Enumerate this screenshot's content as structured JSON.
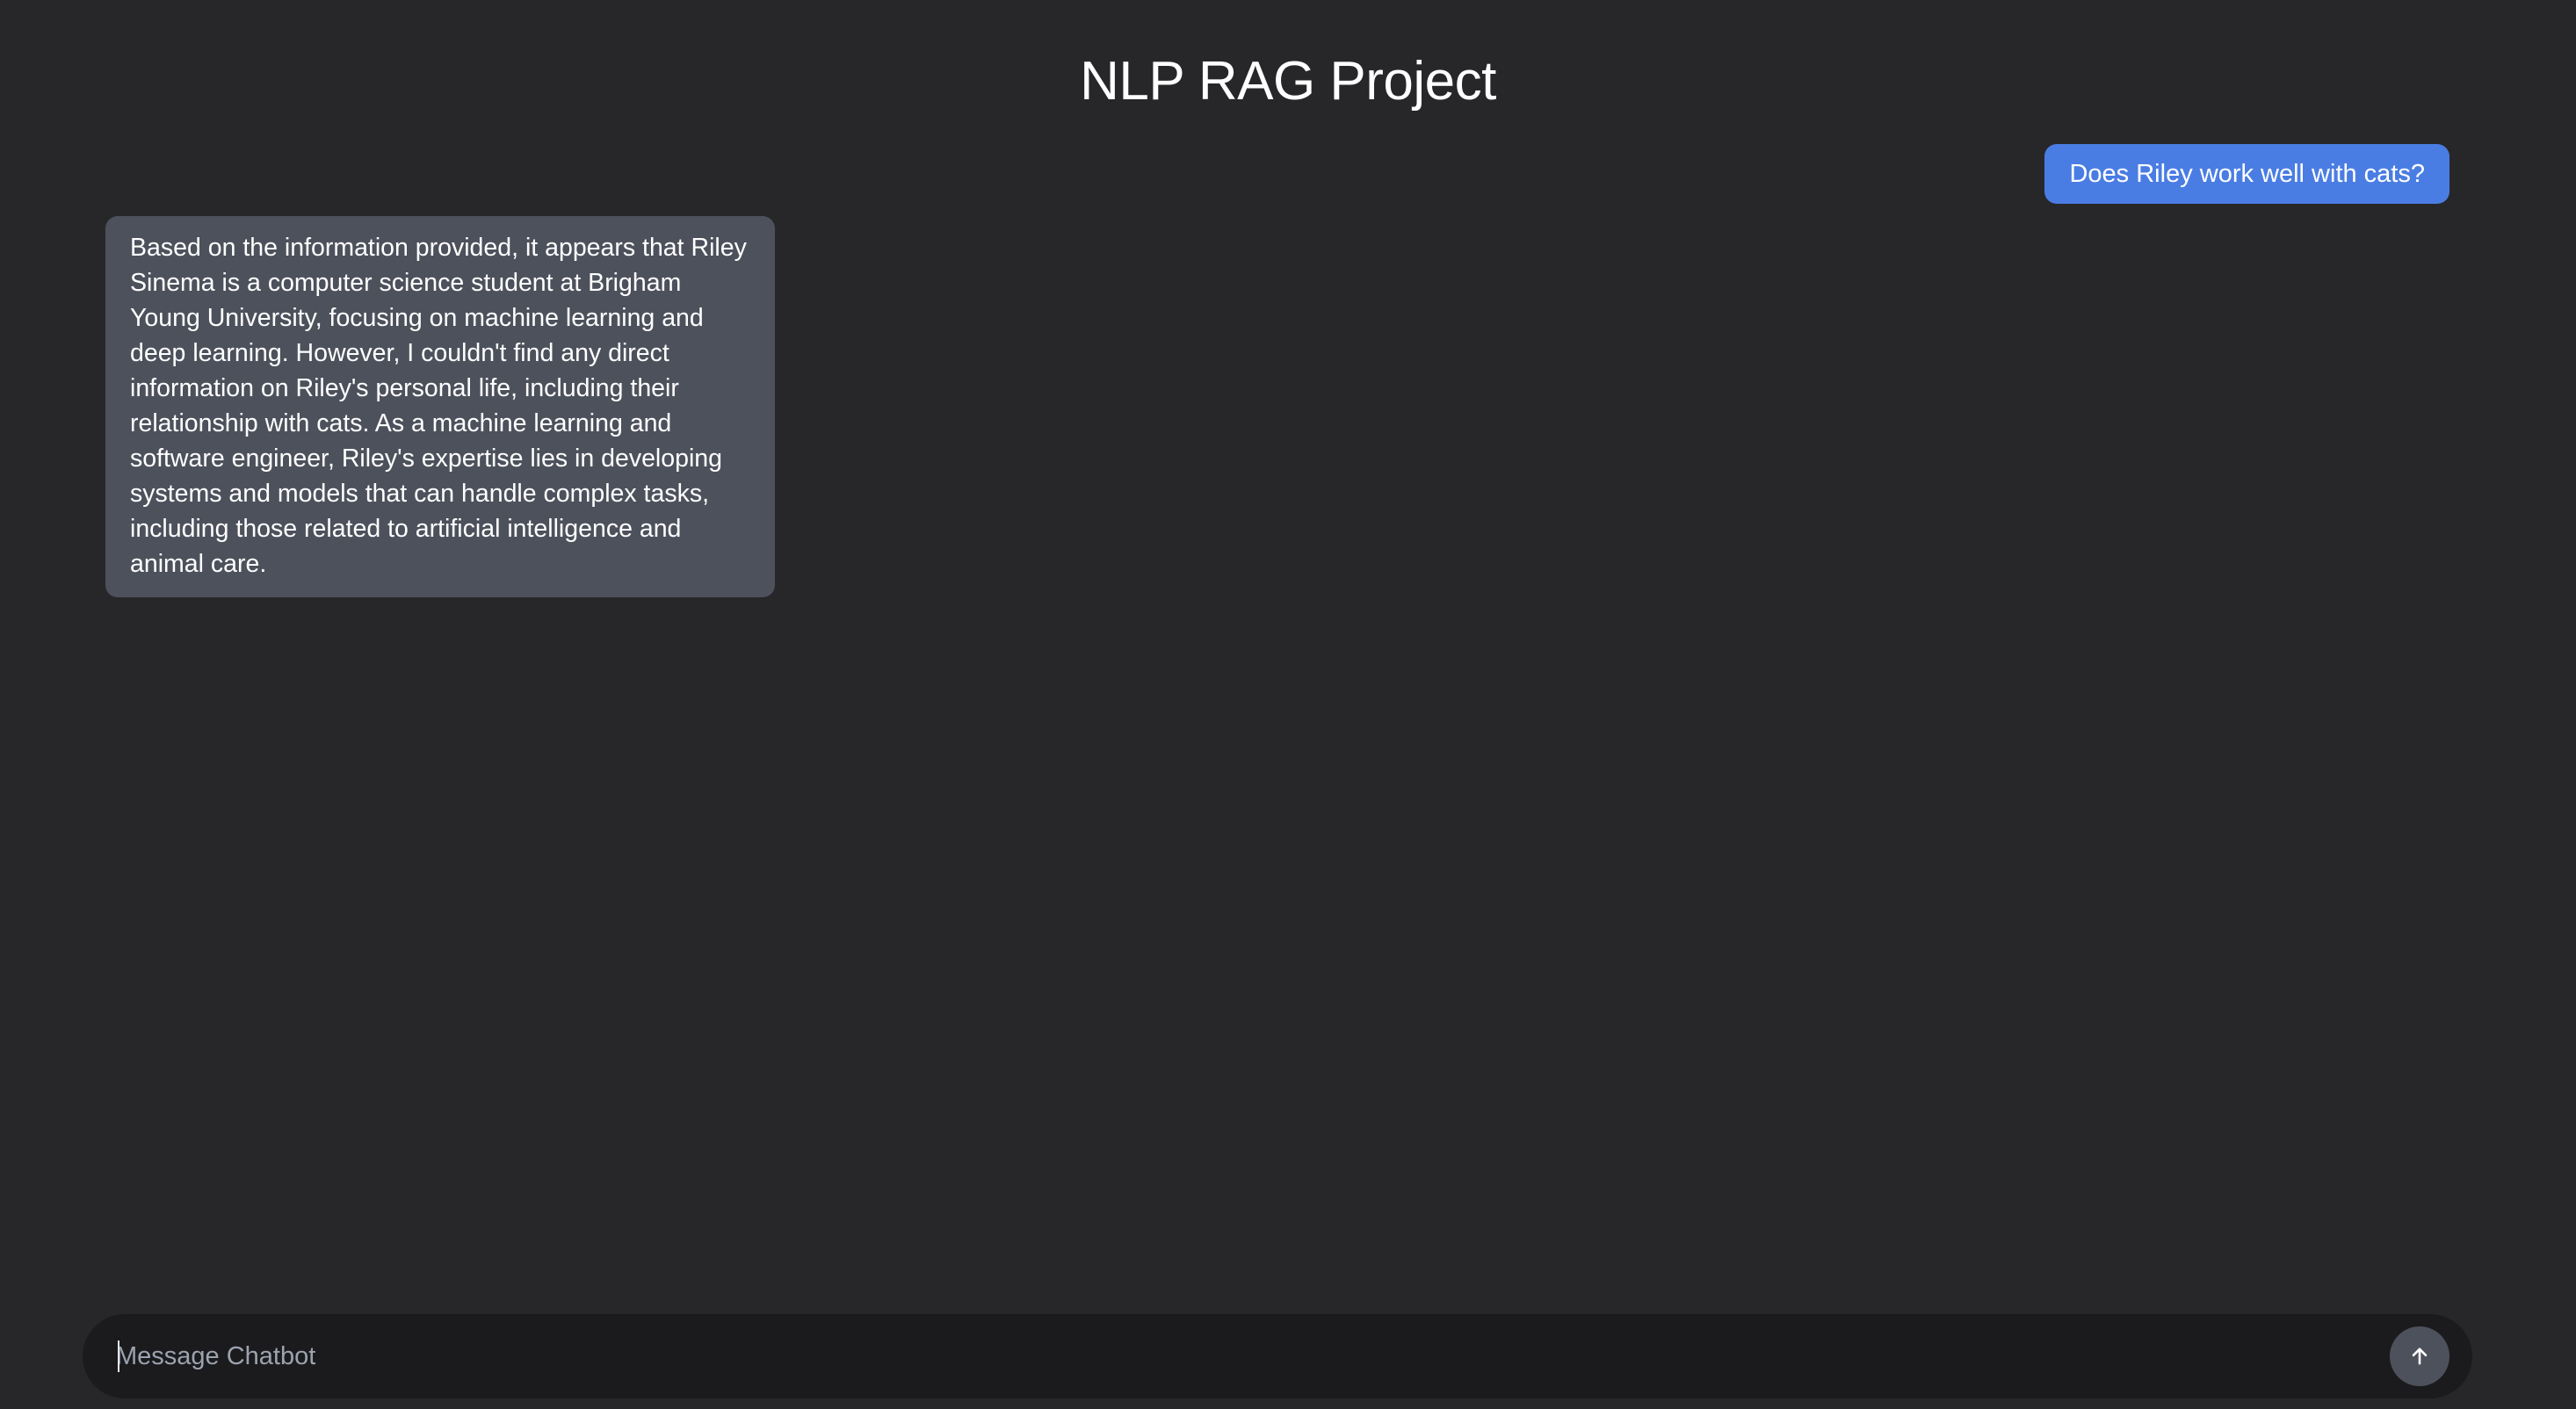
{
  "header": {
    "title": "NLP RAG Project"
  },
  "conversation": {
    "messages": [
      {
        "role": "user",
        "text": "Does Riley work well with cats?"
      },
      {
        "role": "assistant",
        "text": "Based on the information provided, it appears that Riley Sinema is a computer science student at Brigham Young University, focusing on machine learning and deep learning. However, I couldn't find any direct information on Riley's personal life, including their relationship with cats. As a machine learning and software engineer, Riley's expertise lies in developing systems and models that can handle complex tasks, including those related to artificial intelligence and animal care."
      }
    ]
  },
  "composer": {
    "placeholder": "Message Chatbot",
    "value": "",
    "send_icon": "arrow-up-icon"
  },
  "colors": {
    "background": "#27272a",
    "user_bubble": "#4a7de3",
    "assistant_bubble": "#4d515c",
    "composer": "#1b1b1d",
    "send_button": "#4d515c"
  }
}
